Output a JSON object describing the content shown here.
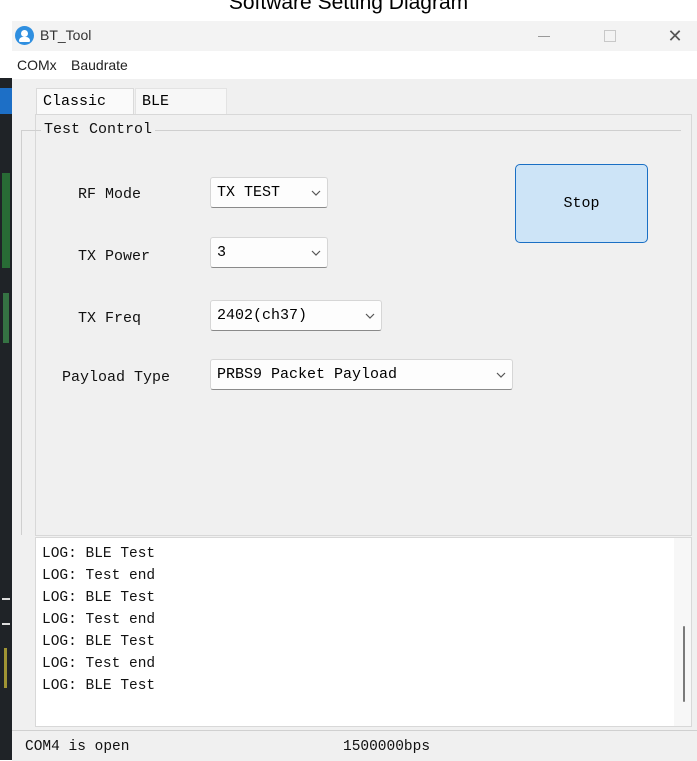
{
  "caption": "Software Setting Diagram",
  "window": {
    "title": "BT_Tool",
    "icon": "user-circle-icon",
    "controls": {
      "minimize_icon": "minimize-icon",
      "maximize_icon": "maximize-icon",
      "close_label": "✕"
    }
  },
  "menu": [
    "COMx",
    "Baudrate"
  ],
  "tabs": [
    {
      "label": "Classic",
      "selected": true
    },
    {
      "label": "BLE",
      "selected": false
    }
  ],
  "group": {
    "label": "Test Control",
    "fields": [
      {
        "label": "RF Mode",
        "value": "TX TEST"
      },
      {
        "label": "TX Power",
        "value": "3"
      },
      {
        "label": "TX Freq",
        "value": "2402(ch37)"
      },
      {
        "label": "Payload Type",
        "value": "PRBS9 Packet Payload"
      }
    ],
    "action_button": "Stop"
  },
  "log": [
    "LOG: BLE Test",
    "LOG: Test end",
    "LOG: BLE Test",
    "LOG: Test end",
    "LOG: BLE Test",
    "LOG: Test end",
    "LOG: BLE Test"
  ],
  "status": {
    "port": "COM4 is open",
    "baud": "1500000bps"
  },
  "colors": {
    "button_fill": "#cde4f7",
    "button_border": "#1a6fc4",
    "app_icon": "#2f8fe0"
  }
}
